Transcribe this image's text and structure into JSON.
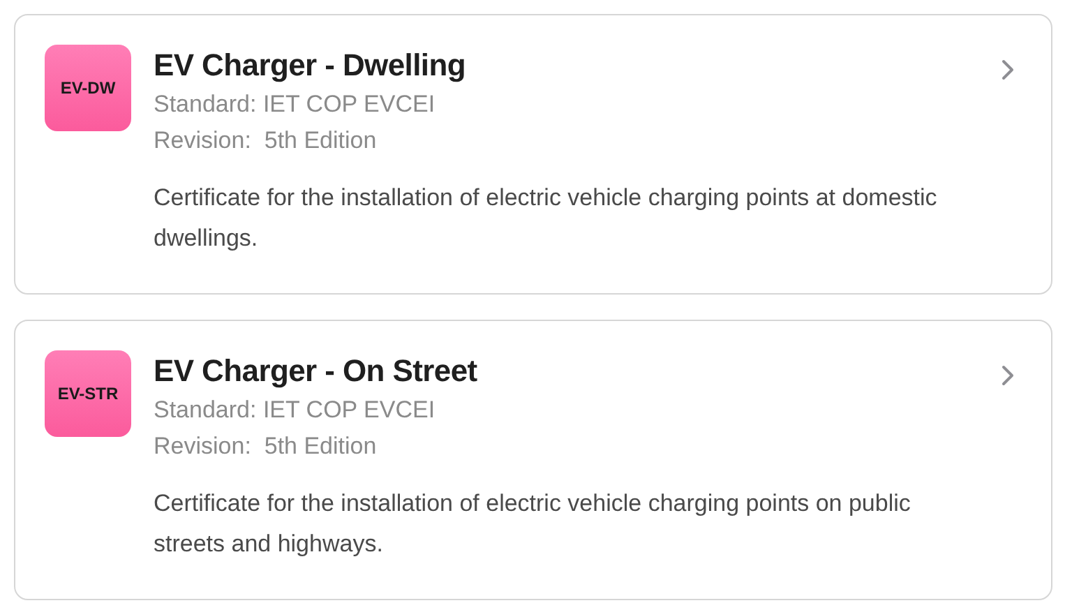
{
  "certificates": [
    {
      "badge": "EV-DW",
      "title": "EV Charger - Dwelling",
      "standard": "Standard: IET COP EVCEI",
      "revision": "Revision:  5th Edition",
      "description": "Certificate for the installation of electric vehicle charging points at domestic dwellings."
    },
    {
      "badge": "EV-STR",
      "title": "EV Charger - On Street",
      "standard": "Standard: IET COP EVCEI",
      "revision": "Revision:  5th Edition",
      "description": "Certificate for the installation of electric vehicle charging points on public streets and highways."
    }
  ]
}
